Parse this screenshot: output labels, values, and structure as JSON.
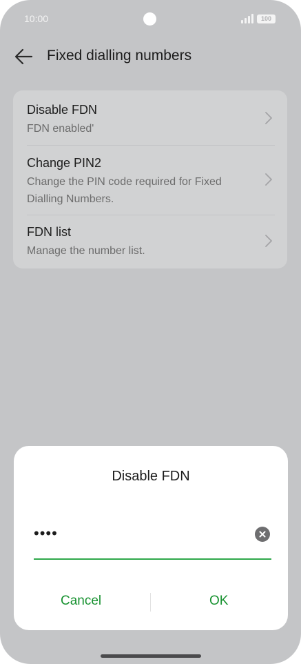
{
  "status_bar": {
    "time": "10:00",
    "battery": "100"
  },
  "app_bar": {
    "title": "Fixed dialling numbers"
  },
  "settings": [
    {
      "title": "Disable FDN",
      "subtitle": "FDN enabled'"
    },
    {
      "title": "Change PIN2",
      "subtitle": "Change the PIN code required for Fixed Dialling Numbers."
    },
    {
      "title": "FDN list",
      "subtitle": "Manage the number list."
    }
  ],
  "dialog": {
    "title": "Disable FDN",
    "pin_value": "••••",
    "cancel_label": "Cancel",
    "ok_label": "OK"
  },
  "colors": {
    "accent": "#16912f",
    "field_underline": "#2ea84a",
    "background": "#c4c5c7",
    "card": "#d1d2d3"
  }
}
